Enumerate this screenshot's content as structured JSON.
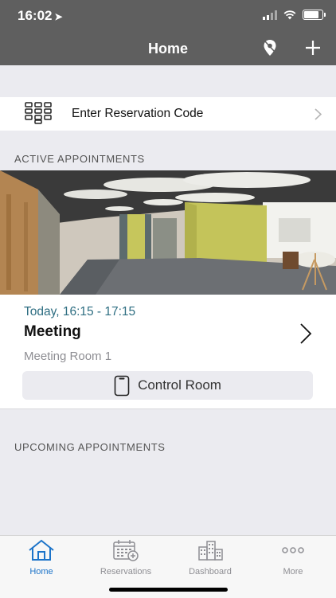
{
  "status_bar": {
    "time": "16:02"
  },
  "nav": {
    "title": "Home"
  },
  "reservation_code": {
    "label": "Enter Reservation Code"
  },
  "active": {
    "section_label": "ACTIVE APPOINTMENTS",
    "appointment": {
      "time": "Today, 16:15 - 17:15",
      "title": "Meeting",
      "room": "Meeting Room 1",
      "control_label": "Control Room"
    }
  },
  "upcoming": {
    "section_label": "UPCOMING APPOINTMENTS"
  },
  "tabs": [
    {
      "label": "Home",
      "icon": "home-icon",
      "active": true
    },
    {
      "label": "Reservations",
      "icon": "calendar-add-icon",
      "active": false
    },
    {
      "label": "Dashboard",
      "icon": "buildings-icon",
      "active": false
    },
    {
      "label": "More",
      "icon": "more-icon",
      "active": false
    }
  ],
  "colors": {
    "header": "#5f5f5f",
    "accent": "#1d74c9",
    "time_text": "#2e6e82",
    "background": "#ebebf0"
  }
}
